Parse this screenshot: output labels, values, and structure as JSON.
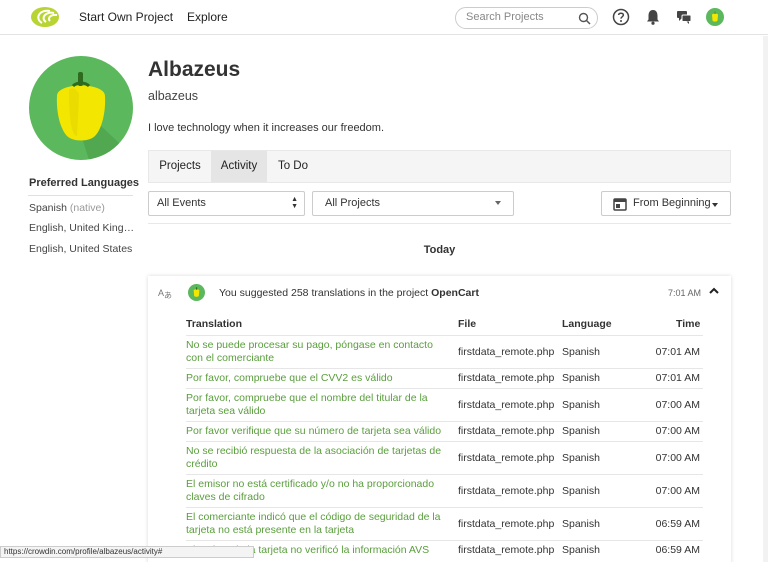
{
  "header": {
    "nav": [
      "Start Own Project",
      "Explore"
    ],
    "search_placeholder": "Search Projects"
  },
  "profile": {
    "display_name": "Albazeus",
    "username": "albazeus",
    "bio": "I love technology when it increases our freedom."
  },
  "languages": {
    "title": "Preferred Languages",
    "items": [
      {
        "label": "Spanish",
        "note": "(native)"
      },
      {
        "label": "English, United Kingdom",
        "note": ""
      },
      {
        "label": "English, United States",
        "note": ""
      }
    ]
  },
  "tabs": [
    {
      "label": "Projects",
      "active": false
    },
    {
      "label": "Activity",
      "active": true
    },
    {
      "label": "To Do",
      "active": false
    }
  ],
  "filters": {
    "events": "All Events",
    "projects": "All Projects",
    "range": "From Beginning"
  },
  "day_label": "Today",
  "activity": {
    "summary_prefix": "You suggested 258 translations in the project",
    "project": "OpenCart",
    "time": "7:01 AM",
    "columns": [
      "Translation",
      "File",
      "Language",
      "Time"
    ],
    "rows": [
      {
        "translation": "No se puede procesar su pago, póngase en contacto con el comerciante",
        "file": "firstdata_remote.php",
        "language": "Spanish",
        "time": "07:01 AM"
      },
      {
        "translation": "Por favor, compruebe que el CVV2 es válido",
        "file": "firstdata_remote.php",
        "language": "Spanish",
        "time": "07:01 AM"
      },
      {
        "translation": "Por favor, compruebe que el nombre del titular de la tarjeta sea válido",
        "file": "firstdata_remote.php",
        "language": "Spanish",
        "time": "07:00 AM"
      },
      {
        "translation": "Por favor verifique que su número de tarjeta sea válido",
        "file": "firstdata_remote.php",
        "language": "Spanish",
        "time": "07:00 AM"
      },
      {
        "translation": "No se recibió respuesta de la asociación de tarjetas de crédito",
        "file": "firstdata_remote.php",
        "language": "Spanish",
        "time": "07:00 AM"
      },
      {
        "translation": "El emisor no está certificado y/o no ha proporcionado claves de cifrado",
        "file": "firstdata_remote.php",
        "language": "Spanish",
        "time": "07:00 AM"
      },
      {
        "translation": "El comerciante indicó que el código de seguridad de la tarjeta no está presente en la tarjeta",
        "file": "firstdata_remote.php",
        "language": "Spanish",
        "time": "06:59 AM"
      },
      {
        "translation": "El emisor de la tarjeta no verificó la información AVS",
        "file": "firstdata_remote.php",
        "language": "Spanish",
        "time": "06:59 AM"
      }
    ]
  },
  "status_url": "https://crowdin.com/profile/albazeus/activity#",
  "colors": {
    "brand_green": "#5cb85c",
    "link_green": "#5a9e3d",
    "pepper_yellow": "#f3e600"
  }
}
